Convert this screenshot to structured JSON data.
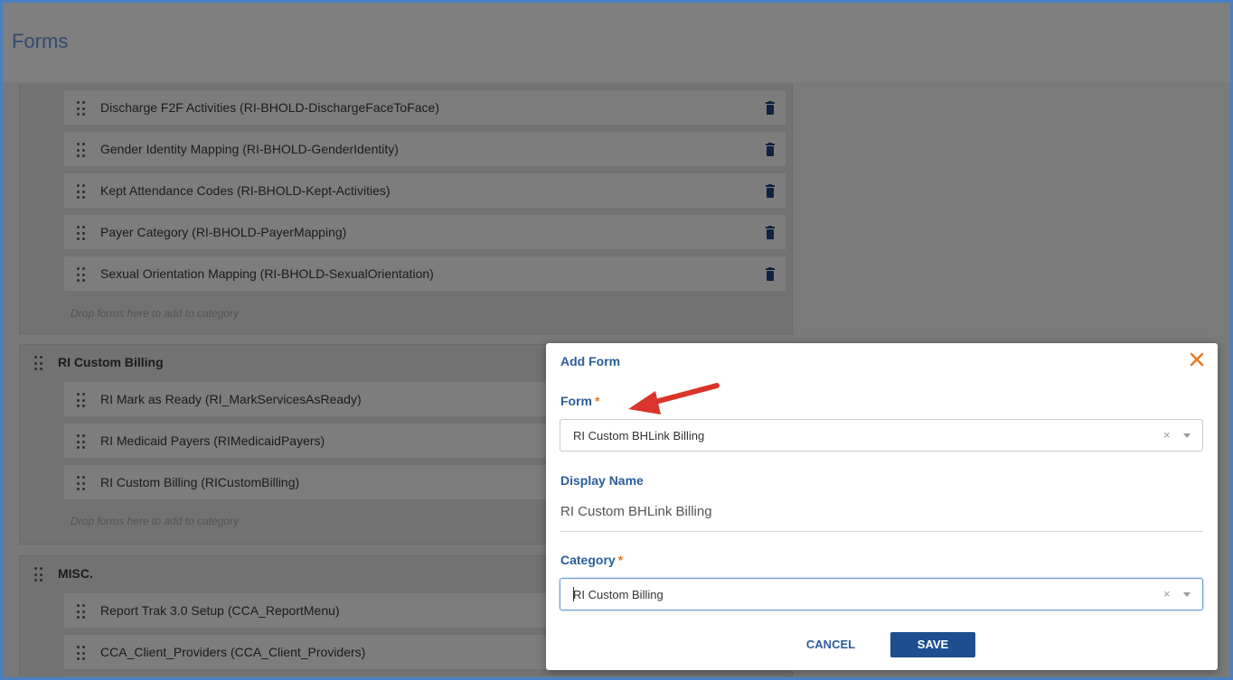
{
  "page": {
    "title": "Forms"
  },
  "categories": [
    {
      "name": "",
      "forms": [
        "Discharge F2F Activities (RI-BHOLD-DischargeFaceToFace)",
        "Gender Identity Mapping (RI-BHOLD-GenderIdentity)",
        "Kept Attendance Codes (RI-BHOLD-Kept-Activities)",
        "Payer Category (RI-BHOLD-PayerMapping)",
        "Sexual Orientation Mapping (RI-BHOLD-SexualOrientation)"
      ],
      "drop_hint": "Drop forms here to add to category"
    },
    {
      "name": "RI Custom Billing",
      "forms": [
        "RI Mark as Ready (RI_MarkServicesAsReady)",
        "RI Medicaid Payers (RIMedicaidPayers)",
        "RI Custom Billing (RICustomBilling)"
      ],
      "drop_hint": "Drop forms here to add to category"
    },
    {
      "name": "MISC.",
      "forms": [
        "Report Trak 3.0 Setup (CCA_ReportMenu)",
        "CCA_Client_Providers (CCA_Client_Providers)"
      ]
    }
  ],
  "modal": {
    "title": "Add Form",
    "form_label": "Form",
    "form_value": "RI Custom BHLink Billing",
    "display_name_label": "Display Name",
    "display_name_value": "RI Custom BHLink Billing",
    "category_label": "Category",
    "category_value": "RI Custom Billing",
    "required_mark": "*",
    "clear_symbol": "×",
    "cancel_label": "CANCEL",
    "save_label": "SAVE"
  },
  "colors": {
    "accent": "#2b5d99",
    "required": "#e87722",
    "save_button": "#1d4e8f",
    "trash_icon": "#1d3f73",
    "annotation_arrow": "#d9352b"
  },
  "icons": {
    "drag": "drag-handle-icon",
    "delete": "trash-icon",
    "close": "close-icon",
    "dropdown": "chevron-down-icon",
    "clear": "clear-icon"
  }
}
